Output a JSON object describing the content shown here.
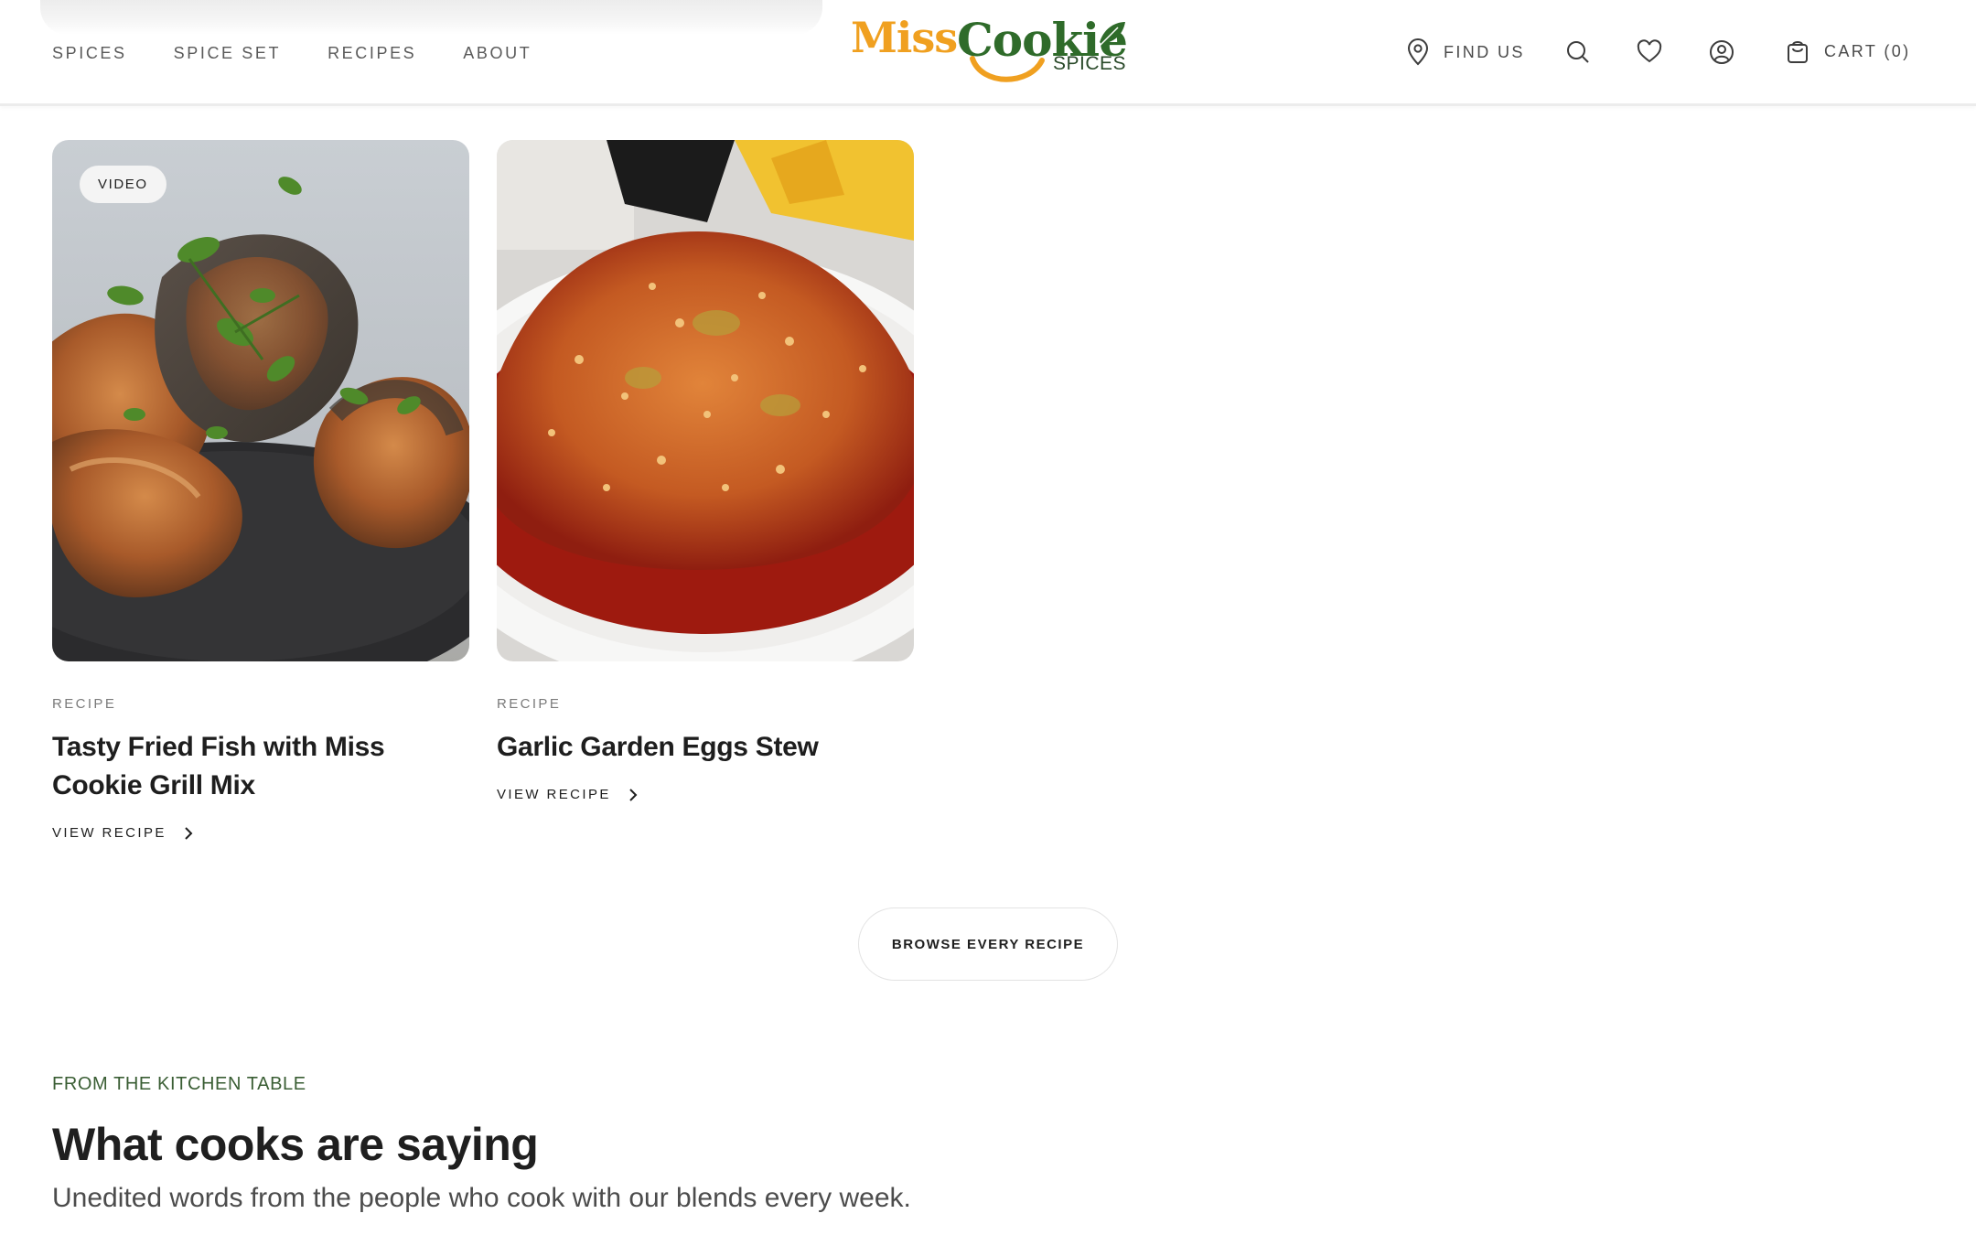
{
  "header": {
    "nav_left": [
      "SPICES",
      "SPICE SET",
      "RECIPES",
      "ABOUT"
    ],
    "logo": {
      "word1": "Miss",
      "word2": "Cookie",
      "word3": "SPICES"
    },
    "find_us": "FIND US",
    "cart": "CART (0)",
    "icons": [
      "location-pin-icon",
      "search-icon",
      "heart-icon",
      "account-icon",
      "bag-icon"
    ]
  },
  "recipes": [
    {
      "badge": "VIDEO",
      "kicker": "RECIPE",
      "title": "Tasty Fried Fish with Miss Cookie Grill Mix",
      "cta": "VIEW RECIPE"
    },
    {
      "badge": "",
      "kicker": "RECIPE",
      "title": "Garlic Garden Eggs Stew",
      "cta": "VIEW RECIPE"
    }
  ],
  "browse_button": "BROWSE EVERY RECIPE",
  "testimonials": {
    "kicker": "FROM THE KITCHEN TABLE",
    "title": "What cooks are saying",
    "subtitle": "Unedited words from the people who cook with our blends every week."
  },
  "colors": {
    "brand_orange": "#f0a020",
    "brand_green": "#2f6b2a",
    "kicker_green": "#3a5e34"
  }
}
